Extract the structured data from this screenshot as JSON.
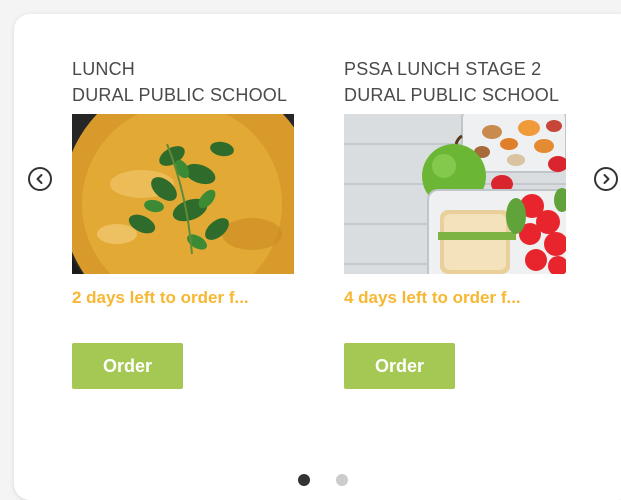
{
  "carousel": {
    "items": [
      {
        "title_line1": "LUNCH",
        "title_line2": "DURAL PUBLIC SCHOOL",
        "image": "soup-with-herbs",
        "days_left": "2 days left to order f...",
        "button_label": "Order"
      },
      {
        "title_line1": "PSSA LUNCH STAGE 2",
        "title_line2": "DURAL PUBLIC SCHOOL",
        "image": "lunchbox-sandwich-apple",
        "days_left": "4 days left to order f...",
        "button_label": "Order"
      }
    ],
    "prev_icon": "chevron-left-circle-icon",
    "next_icon": "chevron-right-circle-icon",
    "page_count": 2,
    "active_page": 1
  },
  "colors": {
    "accent_orange": "#f7b733",
    "button_green": "#a4c853",
    "title_text": "#4a4a4a"
  }
}
